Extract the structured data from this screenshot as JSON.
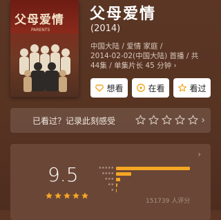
{
  "poster": {
    "title_text": "父母爱情",
    "subtitle_text": "PARENTS"
  },
  "movie": {
    "title": "父母爱情",
    "year": "(2014)",
    "meta_lines": [
      "中国大陆 / 爱情 家庭 /",
      "2014-02-02(中国大陆) 首播 / 共",
      "44集 / 单集片长 45 分钟 ›"
    ]
  },
  "actions": {
    "want": "想看",
    "watching": "在看",
    "watched": "看过"
  },
  "rate_prompt": {
    "text": "已看过？记录此刻感受",
    "star_count": 5
  },
  "rating": {
    "score": "9.5",
    "stars": 5,
    "distribution_fraction": [
      0.86,
      0.18,
      0.05,
      0.02,
      0.01
    ],
    "count_text": "151739 人评分"
  },
  "colors": {
    "accent": "#f5a623",
    "background": "#5a3524"
  }
}
